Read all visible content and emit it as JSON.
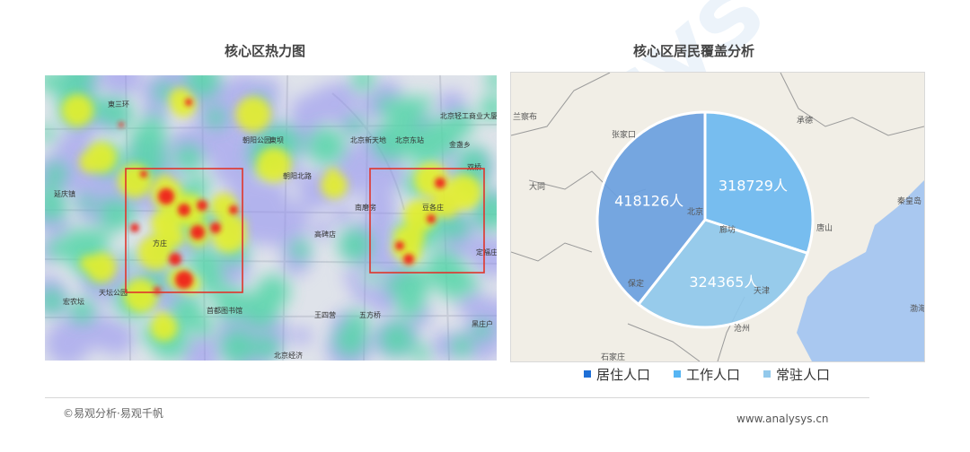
{
  "left_title": "核心区热力图",
  "right_title": "核心区居民覆盖分析",
  "heatmap_labels": [
    "東三环",
    "朝阳公园",
    "朝阳北路",
    "東坝",
    "北京新天地",
    "北京轻工商业大厦",
    "金盏乡",
    "北京东站",
    "高碑店",
    "天坛公园",
    "首都图书馆",
    "王四营",
    "五方桥",
    "北京经济",
    "宏农坛",
    "方庄",
    "豆各庄",
    "定福庄",
    "黑庄户",
    "南磨房",
    "延庆镇",
    "双桥"
  ],
  "map_labels": [
    "兰察布",
    "张家口",
    "大同",
    "承德",
    "北京",
    "秦皇岛",
    "唐山",
    "廊坊",
    "保定",
    "天津",
    "沧州",
    "渤海",
    "石家庄"
  ],
  "chart_data": {
    "type": "pie",
    "title": "核心区居民覆盖分析",
    "slices": [
      {
        "name": "工作人口",
        "value": 318729,
        "label": "318729人",
        "color": "#6cb8f0"
      },
      {
        "name": "常驻人口",
        "value": 324365,
        "label": "324365人",
        "color": "#8fc8ec"
      },
      {
        "name": "居住人口",
        "value": 418126,
        "label": "418126人",
        "color": "#6a9fe0"
      }
    ],
    "legend": [
      {
        "name": "居住人口",
        "color": "#1e6fd6"
      },
      {
        "name": "工作人口",
        "color": "#56b5f3"
      },
      {
        "name": "常驻人口",
        "color": "#93c9eb"
      }
    ],
    "legend_position": "bottom"
  },
  "footer": {
    "left": "©易观分析·易观千帆",
    "right": "www.analysys.cn"
  },
  "watermark": "ysys"
}
